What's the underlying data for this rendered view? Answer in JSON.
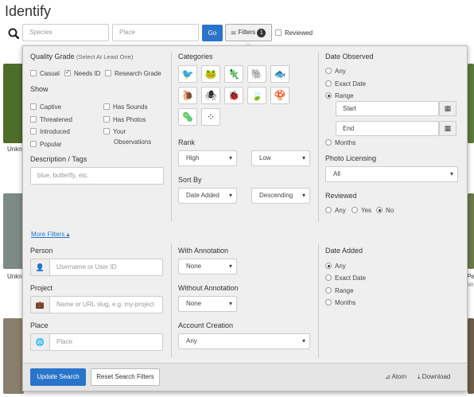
{
  "page": {
    "title": "Identify"
  },
  "search": {
    "species_placeholder": "Species",
    "place_placeholder": "Place",
    "go_label": "Go",
    "filters_label": "Filters",
    "filters_count": "1",
    "reviewed_label": "Reviewed"
  },
  "background": {
    "labels": [
      "Unkn",
      "Unkn",
      "Per",
      "ses"
    ]
  },
  "quality": {
    "heading": "Quality Grade",
    "hint": "(Select At Least One)",
    "casual": "Casual",
    "needs_id": "Needs ID",
    "research": "Research Grade",
    "checked": [
      "Needs ID"
    ]
  },
  "show": {
    "heading": "Show",
    "captive": "Captive",
    "threatened": "Threatened",
    "introduced": "Introduced",
    "popular": "Popular",
    "has_sounds": "Has Sounds",
    "has_photos": "Has Photos",
    "your_obs_1": "Your",
    "your_obs_2": "Observations"
  },
  "description": {
    "heading": "Description / Tags",
    "placeholder": "blue, butterfly, etc."
  },
  "categories": {
    "heading": "Categories",
    "icons": [
      "bird-icon",
      "amphibian-icon",
      "reptile-icon",
      "mammal-icon",
      "fish-icon",
      "mollusk-icon",
      "arachnid-icon",
      "insect-icon",
      "plant-icon",
      "fungus-icon",
      "protozoa-icon",
      "unknown-icon"
    ],
    "glyphs": [
      "🐦",
      "🐸",
      "🦎",
      "🐘",
      "🐟",
      "🐌",
      "🕷",
      "🐞",
      "🍃",
      "🍄",
      "🦠",
      "⁘"
    ]
  },
  "rank": {
    "heading": "Rank",
    "high": "High",
    "low": "Low"
  },
  "sort": {
    "heading": "Sort By",
    "field": "Date Added",
    "order": "Descending"
  },
  "date_observed": {
    "heading": "Date Observed",
    "any": "Any",
    "exact": "Exact Date",
    "range": "Range",
    "months": "Months",
    "start": "Start",
    "end": "End",
    "selected": "Range"
  },
  "licensing": {
    "heading": "Photo Licensing",
    "value": "All"
  },
  "reviewed": {
    "heading": "Reviewed",
    "any": "Any",
    "yes": "Yes",
    "no": "No",
    "selected": "No"
  },
  "more_filters": "More Filters ▴",
  "person": {
    "heading": "Person",
    "placeholder": "Username or User ID"
  },
  "project": {
    "heading": "Project",
    "placeholder": "Name or URL slug, e.g. my-project"
  },
  "place": {
    "heading": "Place",
    "placeholder": "Place"
  },
  "with_annotation": {
    "heading": "With Annotation",
    "value": "None"
  },
  "without_annotation": {
    "heading": "Without Annotation",
    "value": "None"
  },
  "account_creation": {
    "heading": "Account Creation",
    "value": "Any"
  },
  "date_added": {
    "heading": "Date Added",
    "any": "Any",
    "exact": "Exact Date",
    "range": "Range",
    "months": "Months",
    "selected": "Any"
  },
  "footer": {
    "update": "Update Search",
    "reset": "Reset Search Filters",
    "atom": "Atom",
    "download": "Download"
  },
  "colors": {
    "primary": "#2a74c9",
    "panel": "#efefef"
  }
}
